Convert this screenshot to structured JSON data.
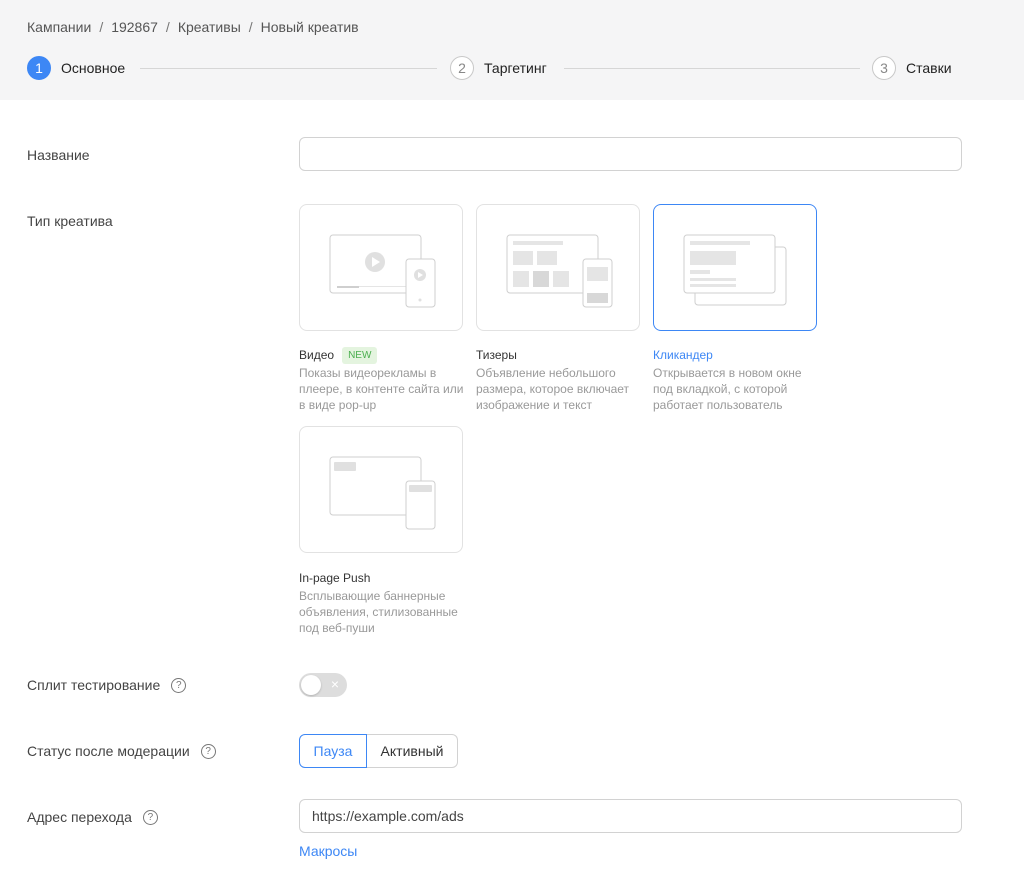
{
  "breadcrumb": [
    "Кампании",
    "192867",
    "Креативы",
    "Новый креатив"
  ],
  "steps": [
    {
      "num": "1",
      "label": "Основное"
    },
    {
      "num": "2",
      "label": "Таргетинг"
    },
    {
      "num": "3",
      "label": "Ставки"
    }
  ],
  "form": {
    "name_label": "Название",
    "name_value": "",
    "type_label": "Тип креатива",
    "creative_types": [
      {
        "title": "Видео",
        "badge": "NEW",
        "desc": "Показы видеорекламы в плеере, в контенте сайта или в виде pop-up"
      },
      {
        "title": "Тизеры",
        "desc": "Объявление небольшого размера, которое включает изображение и текст"
      },
      {
        "title": "Кликандер",
        "desc": "Открывается в новом окне под вкладкой, с которой работает пользователь"
      },
      {
        "title": "In-page Push",
        "desc": "Всплывающие баннерные объявления, стилизованные под веб-пуши"
      }
    ],
    "selected_type": "Кликандер",
    "split_label": "Сплит тестирование",
    "split_on": false,
    "split_off_glyph": "×",
    "help_glyph": "?",
    "status_label": "Статус после модерации",
    "status_options": [
      "Пауза",
      "Активный"
    ],
    "status_selected": "Пауза",
    "url_label": "Адрес перехода",
    "url_value": "https://example.com/ads",
    "macros_link": "Макросы"
  },
  "colors": {
    "accent": "#3d87f5",
    "new_badge_bg": "#e4f4df",
    "new_badge_text": "#4caf50"
  }
}
